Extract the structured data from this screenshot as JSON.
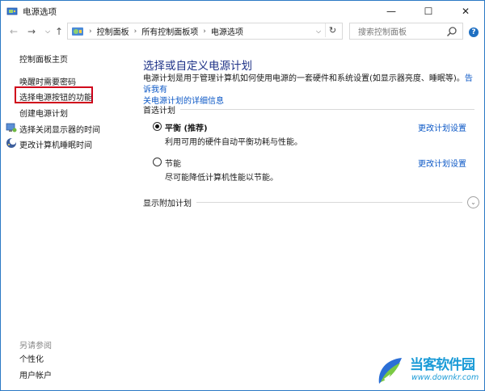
{
  "window": {
    "title": "电源选项",
    "min": "—",
    "max": "☐",
    "close": "✕"
  },
  "nav": {
    "back": "←",
    "forward": "→",
    "recent": "⌵",
    "up": "↑",
    "breadcrumb": [
      "控制面板",
      "所有控制面板项",
      "电源选项"
    ],
    "separator": "›",
    "dropdown": "⌵",
    "refresh": "↻",
    "search_placeholder": "搜索控制面板",
    "help": "?"
  },
  "sidebar": {
    "home": "控制面板主页",
    "items": [
      "唤醒时需要密码",
      "选择电源按钮的功能",
      "创建电源计划",
      "选择关闭显示器的时间",
      "更改计算机睡眠时间"
    ],
    "see_also_title": "另请参阅",
    "see_also": [
      "个性化",
      "用户帐户"
    ]
  },
  "main": {
    "title": "选择或自定义电源计划",
    "description": "电源计划是用于管理计算机如何使用电源的一套硬件和系统设置(如显示器亮度、睡眠等)。",
    "tell_more": "告诉我有关电源计划的详细信息",
    "tell_more_a": "告诉我有",
    "tell_more_b": "关电源计划的详细信息",
    "preferred_label": "首选计划",
    "plans": [
      {
        "name": "平衡 (推荐)",
        "desc": "利用可用的硬件自动平衡功耗与性能。",
        "change": "更改计划设置",
        "selected": true
      },
      {
        "name": "节能",
        "desc": "尽可能降低计算机性能以节能。",
        "change": "更改计划设置",
        "selected": false
      }
    ],
    "show_additional": "显示附加计划",
    "expand": "⌄"
  },
  "watermark": {
    "brand": "当客软件园",
    "url": "www.downkr.com"
  },
  "colors": {
    "accent": "#1e3287",
    "link": "#0b57c6",
    "highlight": "#d0021b",
    "watermark": "#1a9bd7"
  }
}
